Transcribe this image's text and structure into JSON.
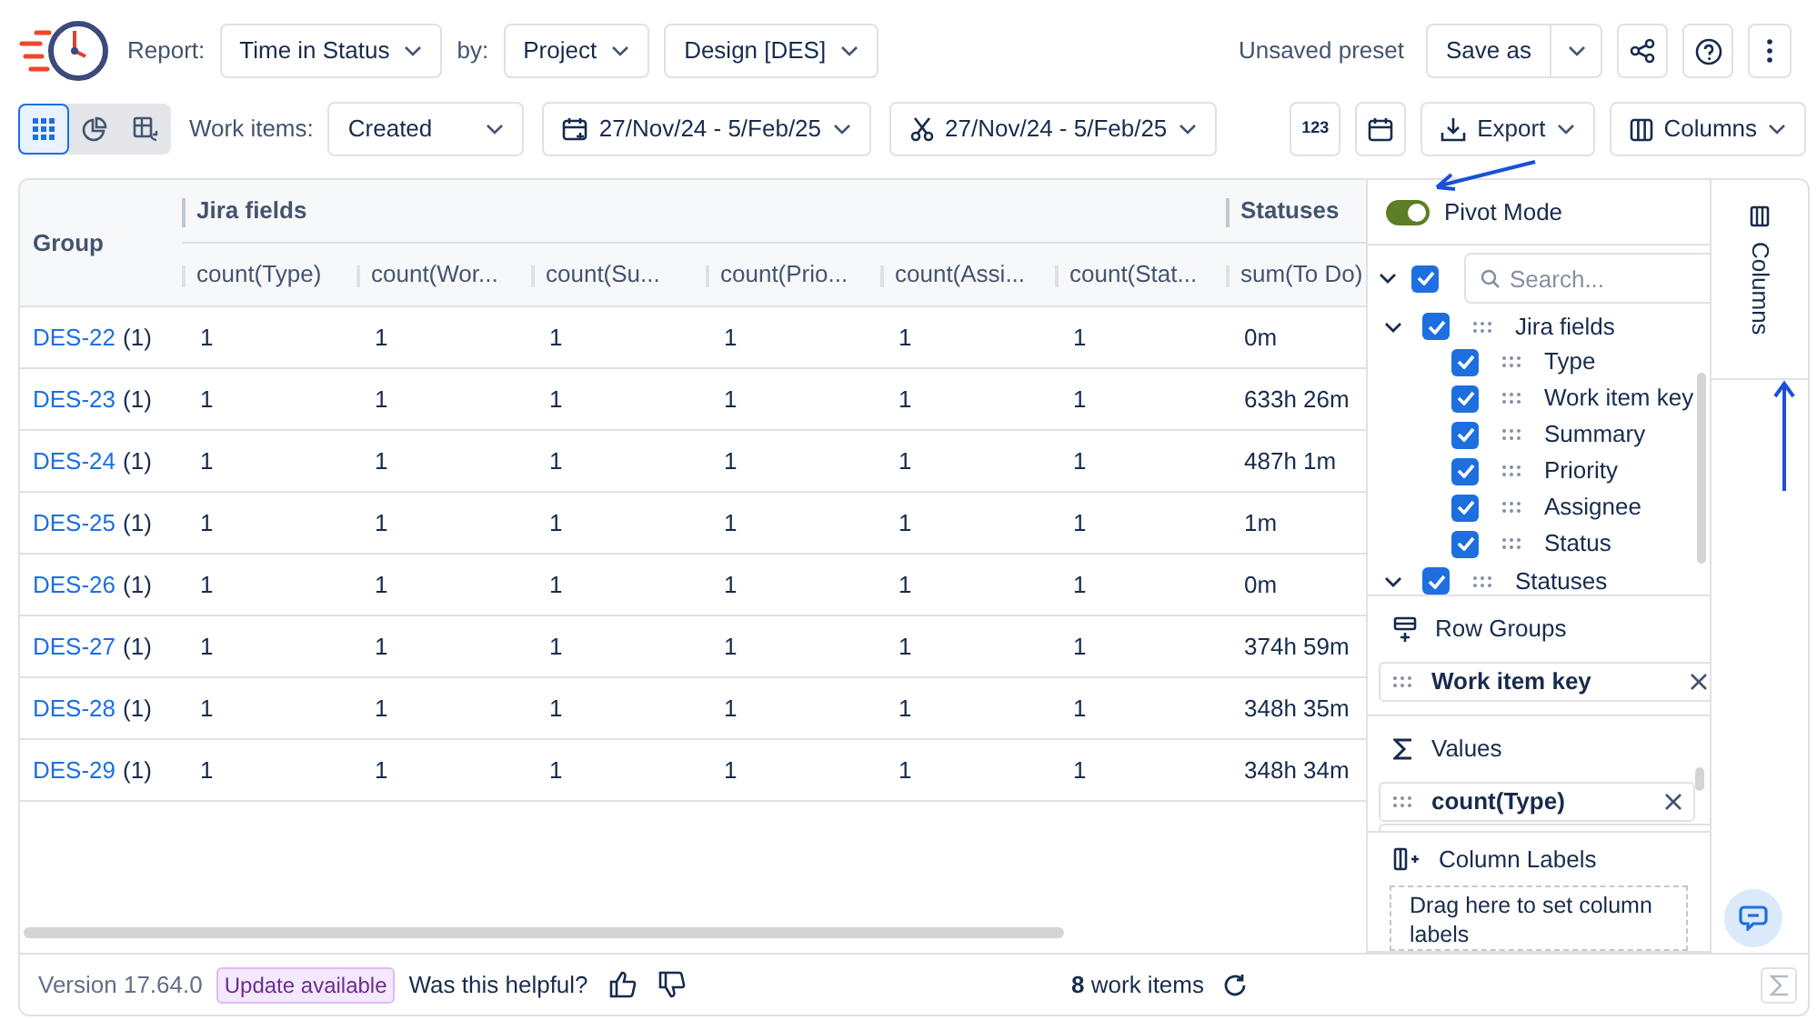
{
  "header": {
    "report_label": "Report:",
    "report": "Time in Status",
    "by_label": "by:",
    "by": "Project",
    "project": "Design [DES]",
    "preset": "Unsaved preset",
    "save": "Save as"
  },
  "toolbar": {
    "view_modes": [
      {
        "kind": "grid",
        "selected": true
      },
      {
        "kind": "chart",
        "selected": false
      },
      {
        "kind": "pivot",
        "selected": false
      }
    ],
    "work_items_label": "Work items:",
    "work_items": "Created",
    "created_range": "27/Nov/24 - 5/Feb/25",
    "resolved_range": "27/Nov/24 - 5/Feb/25",
    "number_format": "123",
    "export": "Export",
    "columns": "Columns"
  },
  "table": {
    "group_header": "Group",
    "column_groups": [
      {
        "label": "Jira fields",
        "columns": [
          "count(Type)",
          "count(Wor...",
          "count(Su...",
          "count(Prio...",
          "count(Assi...",
          "count(Stat..."
        ]
      },
      {
        "label": "Statuses",
        "columns": [
          "sum(To Do)"
        ]
      }
    ],
    "rows": [
      {
        "key": "DES-22",
        "count": "(1)",
        "cells": [
          "1",
          "1",
          "1",
          "1",
          "1",
          "1",
          "0m"
        ]
      },
      {
        "key": "DES-23",
        "count": "(1)",
        "cells": [
          "1",
          "1",
          "1",
          "1",
          "1",
          "1",
          "633h 26m"
        ]
      },
      {
        "key": "DES-24",
        "count": "(1)",
        "cells": [
          "1",
          "1",
          "1",
          "1",
          "1",
          "1",
          "487h 1m"
        ]
      },
      {
        "key": "DES-25",
        "count": "(1)",
        "cells": [
          "1",
          "1",
          "1",
          "1",
          "1",
          "1",
          "1m"
        ]
      },
      {
        "key": "DES-26",
        "count": "(1)",
        "cells": [
          "1",
          "1",
          "1",
          "1",
          "1",
          "1",
          "0m"
        ]
      },
      {
        "key": "DES-27",
        "count": "(1)",
        "cells": [
          "1",
          "1",
          "1",
          "1",
          "1",
          "1",
          "374h 59m"
        ]
      },
      {
        "key": "DES-28",
        "count": "(1)",
        "cells": [
          "1",
          "1",
          "1",
          "1",
          "1",
          "1",
          "348h 35m"
        ]
      },
      {
        "key": "DES-29",
        "count": "(1)",
        "cells": [
          "1",
          "1",
          "1",
          "1",
          "1",
          "1",
          "348h 34m"
        ]
      }
    ]
  },
  "side_panel": {
    "pivot_mode": {
      "label": "Pivot Mode",
      "on": true
    },
    "select_all": {
      "checked": true,
      "expanded": true
    },
    "search": {
      "placeholder": "Search..."
    },
    "tree": [
      {
        "label": "Jira fields",
        "checked": true,
        "expanded": true,
        "children": [
          {
            "label": "Type",
            "checked": true
          },
          {
            "label": "Work item key",
            "checked": true
          },
          {
            "label": "Summary",
            "checked": true
          },
          {
            "label": "Priority",
            "checked": true
          },
          {
            "label": "Assignee",
            "checked": true
          },
          {
            "label": "Status",
            "checked": true
          }
        ]
      },
      {
        "label": "Statuses",
        "checked": true,
        "expanded": true
      }
    ],
    "row_groups": {
      "title": "Row Groups",
      "items": [
        "Work item key"
      ]
    },
    "values": {
      "title": "Values",
      "items": [
        "count(Type)"
      ]
    },
    "column_labels": {
      "title": "Column Labels",
      "hint": "Drag here to set column labels"
    },
    "tab": "Columns"
  },
  "footer": {
    "version": "Version 17.64.0",
    "update": "Update available",
    "helpful": "Was this helpful?",
    "count": "8",
    "count_label": "work items"
  }
}
